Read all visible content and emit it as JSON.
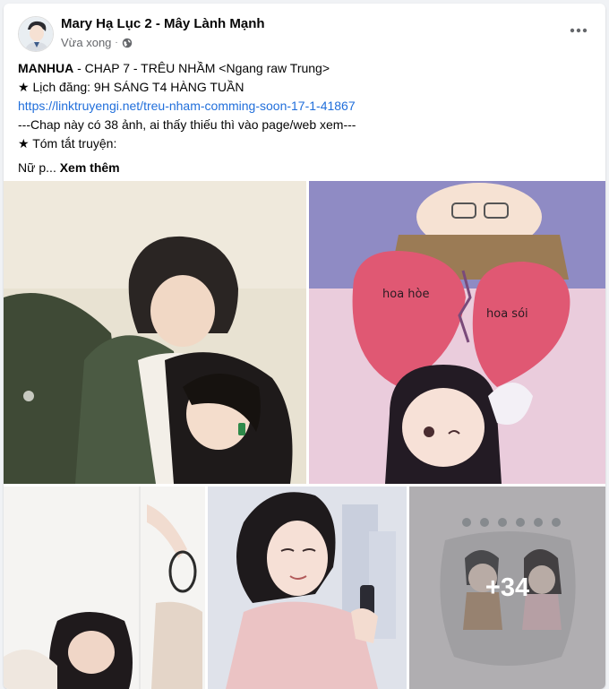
{
  "post": {
    "author": "Mary Hạ Lục 2 - Mây Lành Mạnh",
    "time": "Vừa xong",
    "separator": "·",
    "lines": {
      "l1_bold": "MANHUA",
      "l1_rest": " - CHAP 7  - TRÊU NHẦM <Ngang raw Trung>",
      "l2": "★ Lịch đăng: 9H SÁNG T4 HÀNG TUẦN",
      "l3_link": "https://linktruyengi.net/treu-nham-comming-soon-17-1-41867",
      "l4": "---Chap này có 38 ảnh, ai thấy thiếu thì vào page/web xem---",
      "l5": "★ Tóm tắt truyện:",
      "l6": "Nữ p...",
      "see_more": "Xem thêm"
    },
    "photos": {
      "heart_left": "hoa hòe",
      "heart_right": "hoa sói",
      "more_count": "+34"
    }
  },
  "colors": {
    "link": "#216fdb",
    "secondary_text": "#65676b",
    "background": "#f0f2f5"
  },
  "icons": {
    "globe": "globe-icon",
    "more": "more-horizontal-icon"
  }
}
